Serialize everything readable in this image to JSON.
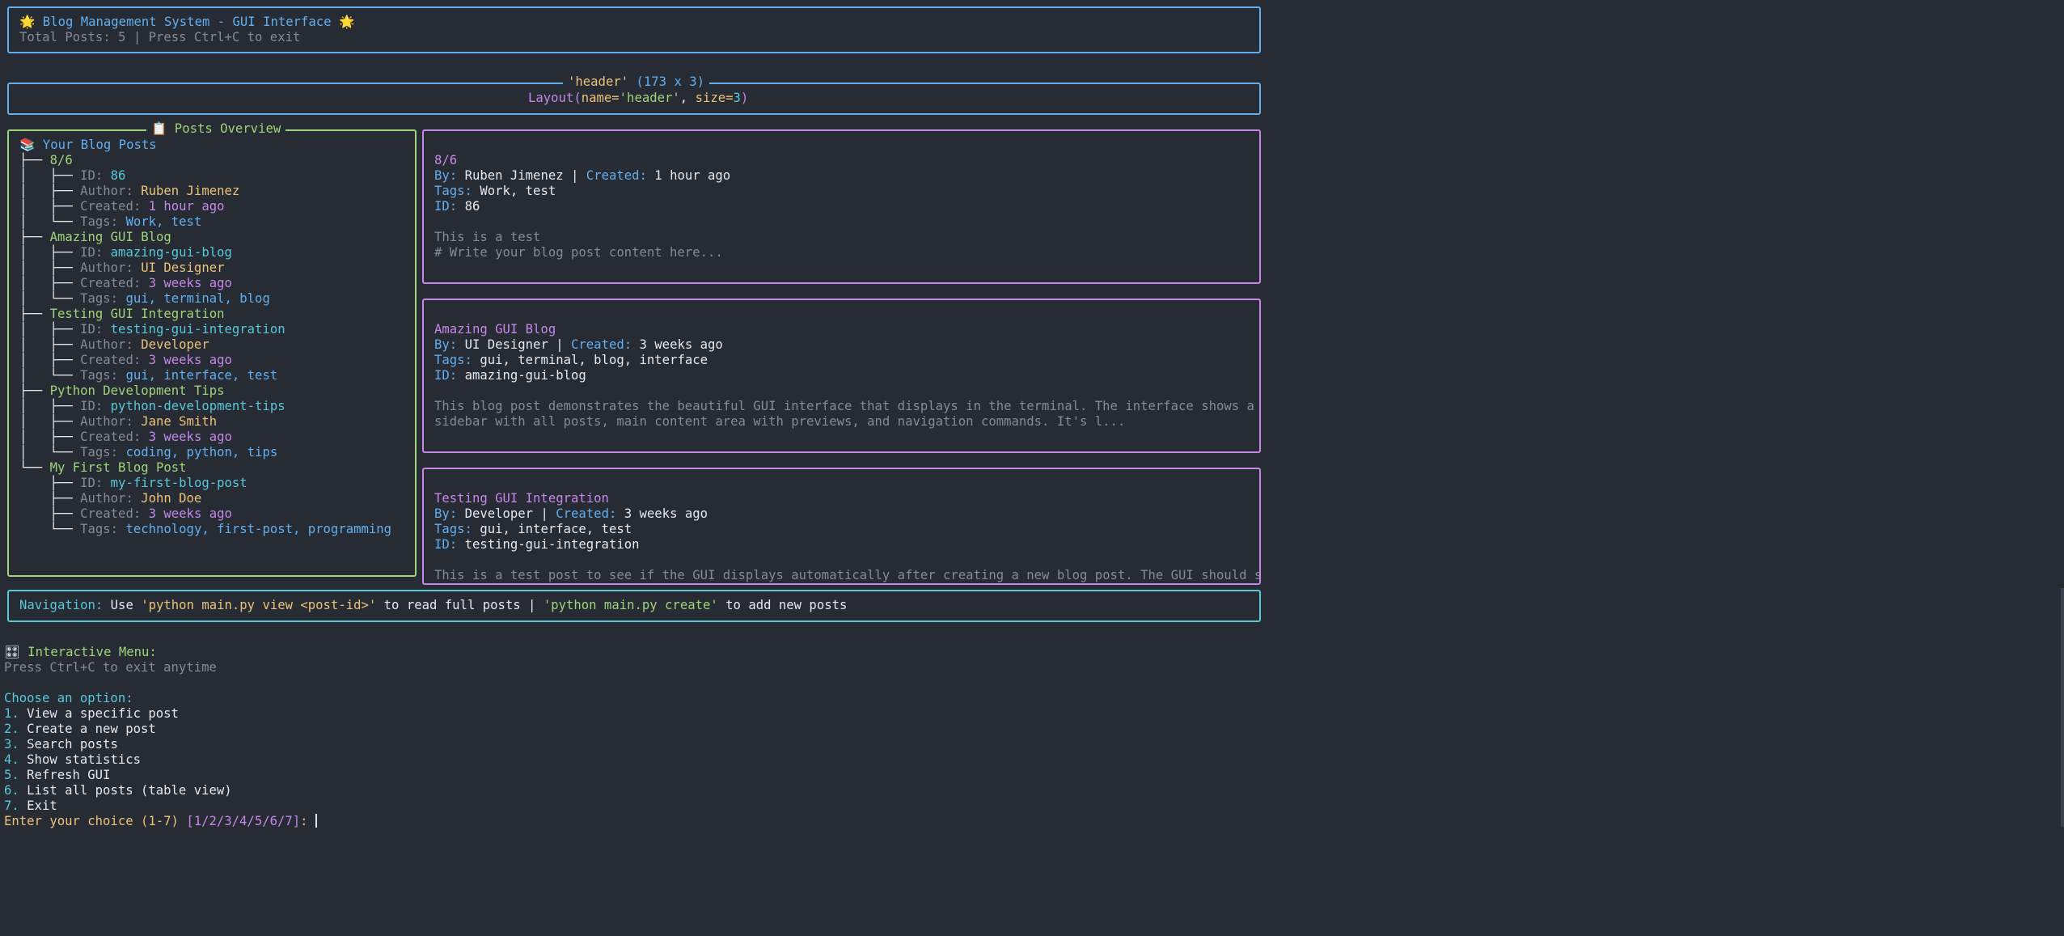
{
  "title_bar": {
    "title": "🌟 Blog Management System - GUI Interface 🌟",
    "subtitle": "Total Posts: 5 | Press Ctrl+C to exit"
  },
  "layout_panel": {
    "title_name": "'header'",
    "title_dims": "(173 x 3)",
    "repr_prefix": "Layout(",
    "repr_name_key": "name=",
    "repr_name_val": "'header'",
    "repr_sep": ", ",
    "repr_size_key": "size=",
    "repr_size_val": "3",
    "repr_suffix": ")"
  },
  "sidebar": {
    "panel_title": "📋 Posts Overview",
    "root_label": "📚 Your Blog Posts",
    "field_labels": {
      "id": "ID: ",
      "author": "Author: ",
      "created": "Created: ",
      "tags": "Tags: "
    },
    "posts": [
      {
        "title": "8/6",
        "id": "86",
        "author": "Ruben Jimenez",
        "created": "1 hour ago",
        "tags": "Work, test"
      },
      {
        "title": "Amazing GUI Blog",
        "id": "amazing-gui-blog",
        "author": "UI Designer",
        "created": "3 weeks ago",
        "tags": "gui, terminal, blog"
      },
      {
        "title": "Testing GUI Integration",
        "id": "testing-gui-integration",
        "author": "Developer",
        "created": "3 weeks ago",
        "tags": "gui, interface, test"
      },
      {
        "title": "Python Development Tips",
        "id": "python-development-tips",
        "author": "Jane Smith",
        "created": "3 weeks ago",
        "tags": "coding, python, tips"
      },
      {
        "title": "My First Blog Post",
        "id": "my-first-blog-post",
        "author": "John Doe",
        "created": "3 weeks ago",
        "tags": "technology, first-post, programming"
      }
    ]
  },
  "previews": {
    "labels": {
      "by": "By: ",
      "sep": " | ",
      "created": "Created: ",
      "tags": "Tags: ",
      "id": "ID: "
    },
    "cards": [
      {
        "title": "8/6",
        "author": "Ruben Jimenez",
        "created": "1 hour ago",
        "tags": "Work, test",
        "id": "86",
        "body1": "This is a test",
        "body2": "# Write your blog post content here..."
      },
      {
        "title": "Amazing GUI Blog",
        "author": "UI Designer",
        "created": "3 weeks ago",
        "tags": "gui, terminal, blog, interface",
        "id": "amazing-gui-blog",
        "body1": "This blog post demonstrates the beautiful GUI interface that displays in the terminal. The interface shows a",
        "body2": "sidebar with all posts, main content area with previews, and navigation commands. It's l..."
      },
      {
        "title": "Testing GUI Integration",
        "author": "Developer",
        "created": "3 weeks ago",
        "tags": "gui, interface, test",
        "id": "testing-gui-integration",
        "body1": "This is a test post to see if the GUI displays automatically after creating a new blog post. The GUI should show",
        "body2": ""
      }
    ]
  },
  "navigation": {
    "label": "Navigation:",
    "use": " Use ",
    "cmd_view": "'python main.py view <post-id>'",
    "mid": " to read full posts | ",
    "cmd_create": "'python main.py create'",
    "end": " to add new posts"
  },
  "menu": {
    "icon": "🎛",
    "title": " Interactive Menu:",
    "hint": "Press Ctrl+C to exit anytime",
    "prompt_header": "Choose an option:",
    "options": [
      {
        "num": "1.",
        "label": " View a specific post"
      },
      {
        "num": "2.",
        "label": " Create a new post"
      },
      {
        "num": "3.",
        "label": " Search posts"
      },
      {
        "num": "4.",
        "label": " Show statistics"
      },
      {
        "num": "5.",
        "label": " Refresh GUI"
      },
      {
        "num": "6.",
        "label": " List all posts (table view)"
      },
      {
        "num": "7.",
        "label": " Exit"
      }
    ],
    "input_prompt": "Enter your choice (1-7)",
    "input_choices": "[1/2/3/4/5/6/7]",
    "input_colon": ": "
  },
  "colors": {
    "background": "#272b34",
    "header_border": "#62aff0",
    "sidebar_border": "#9fd47a",
    "card_border": "#c587e8",
    "nav_border": "#56c8d8"
  }
}
